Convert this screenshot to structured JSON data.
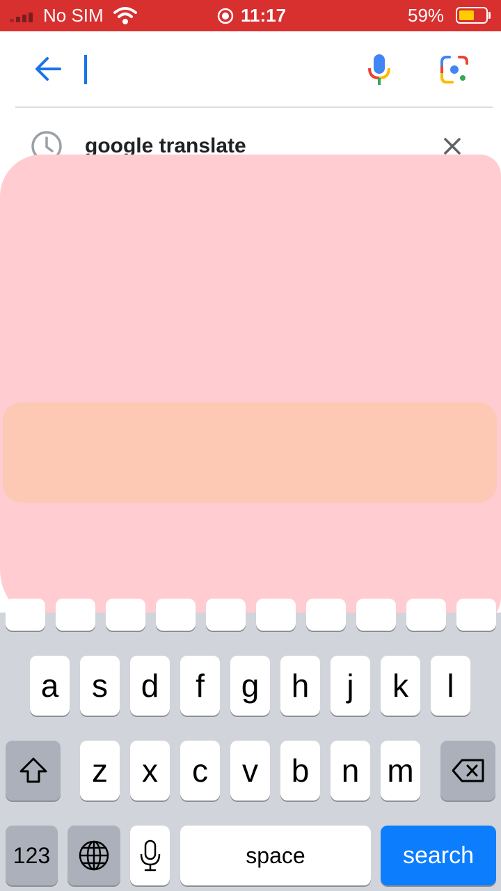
{
  "status_bar": {
    "carrier": "No SIM",
    "time": "11:17",
    "battery_percent": "59%",
    "battery_level": 0.59,
    "background_color": "#d7302f"
  },
  "search_bar": {
    "back_icon": "arrow-left-icon",
    "mic_icon": "google-mic-icon",
    "lens_icon": "google-lens-icon",
    "query": ""
  },
  "history": {
    "items": [
      {
        "label": "google translate",
        "icon": "history-clock-icon",
        "remove_icon": "close-icon"
      }
    ]
  },
  "keyboard": {
    "row1": [
      "a",
      "s",
      "d",
      "f",
      "g",
      "h",
      "j",
      "k",
      "l"
    ],
    "row2": [
      "z",
      "x",
      "c",
      "v",
      "b",
      "n",
      "m"
    ],
    "numbers_label": "123",
    "space_label": "space",
    "search_label": "search",
    "shift_icon": "shift-icon",
    "delete_icon": "backspace-icon",
    "globe_icon": "globe-icon",
    "dictation_icon": "microphone-icon"
  }
}
